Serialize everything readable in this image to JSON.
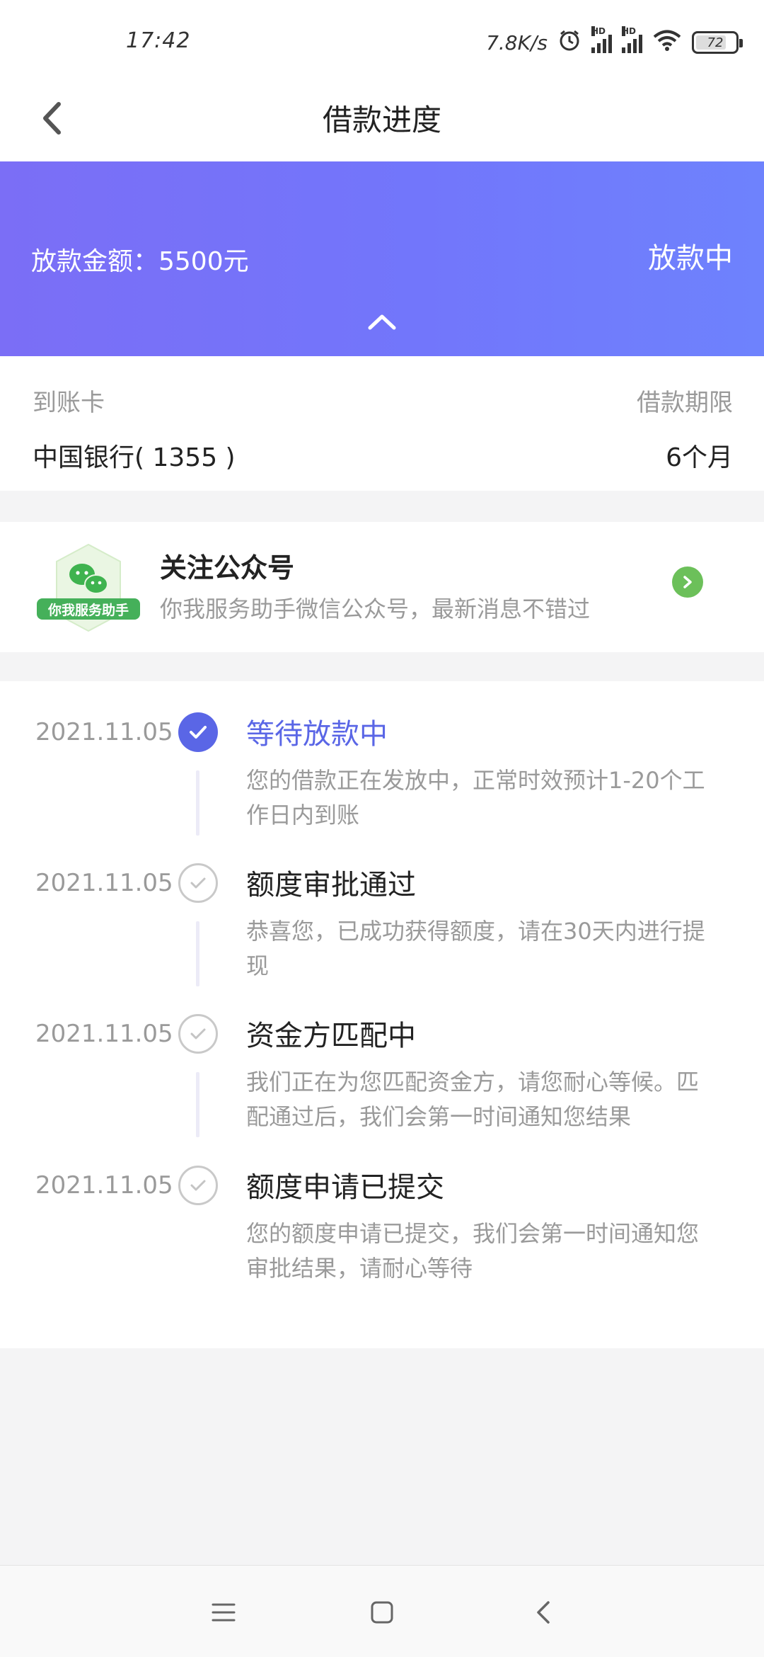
{
  "status_bar": {
    "time": "17:42",
    "net_speed": "7.8K/s",
    "battery": "72",
    "icons": [
      "alarm-icon",
      "signal-hd-icon",
      "signal-hd-icon",
      "wifi-icon",
      "battery-icon"
    ]
  },
  "nav": {
    "title": "借款进度",
    "back_icon": "chevron-left-icon"
  },
  "banner": {
    "amount_text": "放款金额：5500元",
    "status": "放款中",
    "collapse_icon": "chevron-up-icon",
    "gradient": [
      "#7b6ef6",
      "#6e82fd"
    ]
  },
  "info": {
    "card_label": "到账卡",
    "card_value": "中国银行( 1355 )",
    "term_label": "借款期限",
    "term_value": "6个月"
  },
  "follow": {
    "logo_text": "你我服务助手",
    "title": "关注公众号",
    "desc": "你我服务助手微信公众号，最新消息不错过"
  },
  "timeline": [
    {
      "date": "2021.11.05",
      "title": "等待放款中",
      "desc": "您的借款正在发放中，正常时效预计1-20个工作日内到账",
      "state": "current"
    },
    {
      "date": "2021.11.05",
      "title": "额度审批通过",
      "desc": "恭喜您，已成功获得额度，请在30天内进行提现",
      "state": "done"
    },
    {
      "date": "2021.11.05",
      "title": "资金方匹配中",
      "desc": "我们正在为您匹配资金方，请您耐心等候。匹配通过后，我们会第一时间通知您结果",
      "state": "done"
    },
    {
      "date": "2021.11.05",
      "title": "额度申请已提交",
      "desc": "您的额度申请已提交，我们会第一时间通知您审批结果，请耐心等待",
      "state": "done"
    }
  ],
  "colors": {
    "accent": "#5a66e6",
    "wechat_green": "#6cc05a",
    "muted_text": "#9a9a9a"
  }
}
